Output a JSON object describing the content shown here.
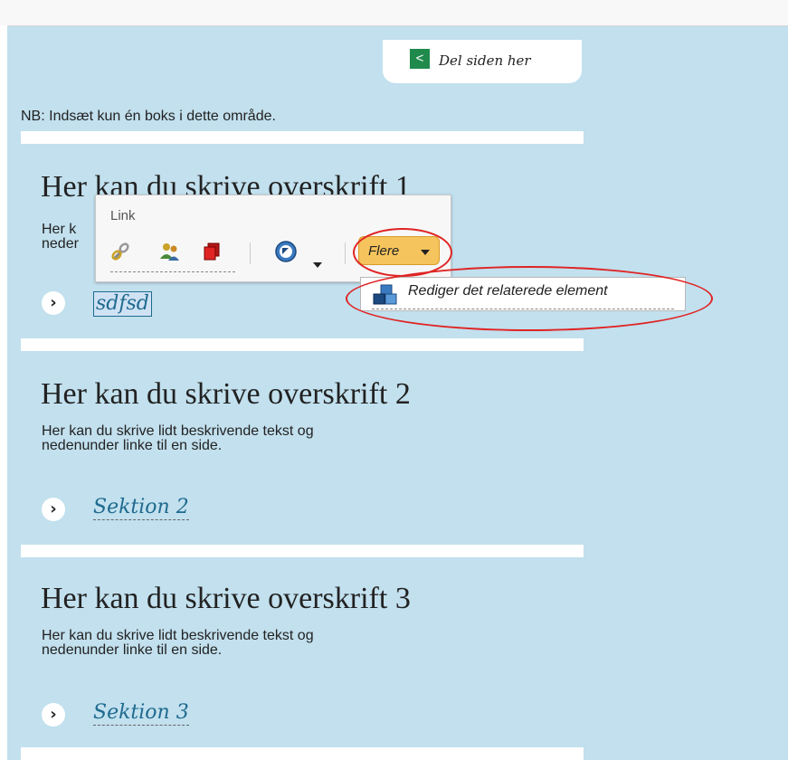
{
  "share": {
    "icon": "share-icon",
    "label": "Del siden her"
  },
  "notice": "NB: Indsæt kun én boks i dette område.",
  "sections": [
    {
      "heading": "Her kan du skrive overskrift 1",
      "desc_line1": "Her k",
      "desc_line2": "neder",
      "link": "sdfsd"
    },
    {
      "heading": "Her kan du skrive overskrift 2",
      "desc_line1": "Her kan du skrive lidt beskrivende tekst og",
      "desc_line2": "nedenunder linke til en side.",
      "link": "Sektion 2"
    },
    {
      "heading": "Her kan du skrive overskrift 3",
      "desc_line1": "Her kan du skrive lidt beskrivende tekst og",
      "desc_line2": "nedenunder linke til en side.",
      "link": "Sektion 3"
    }
  ],
  "toolbar": {
    "label": "Link",
    "icons": [
      "link-icon",
      "users-icon",
      "copy-icon",
      "navigate-icon"
    ],
    "more_label": "Flere",
    "menu_item": "Rediger det relaterede element"
  },
  "colors": {
    "panel": "#c2e0ee",
    "link": "#1f6a8f",
    "highlight": "#f6c45c",
    "annotation": "#e02424",
    "share_green": "#1f8a4c"
  }
}
